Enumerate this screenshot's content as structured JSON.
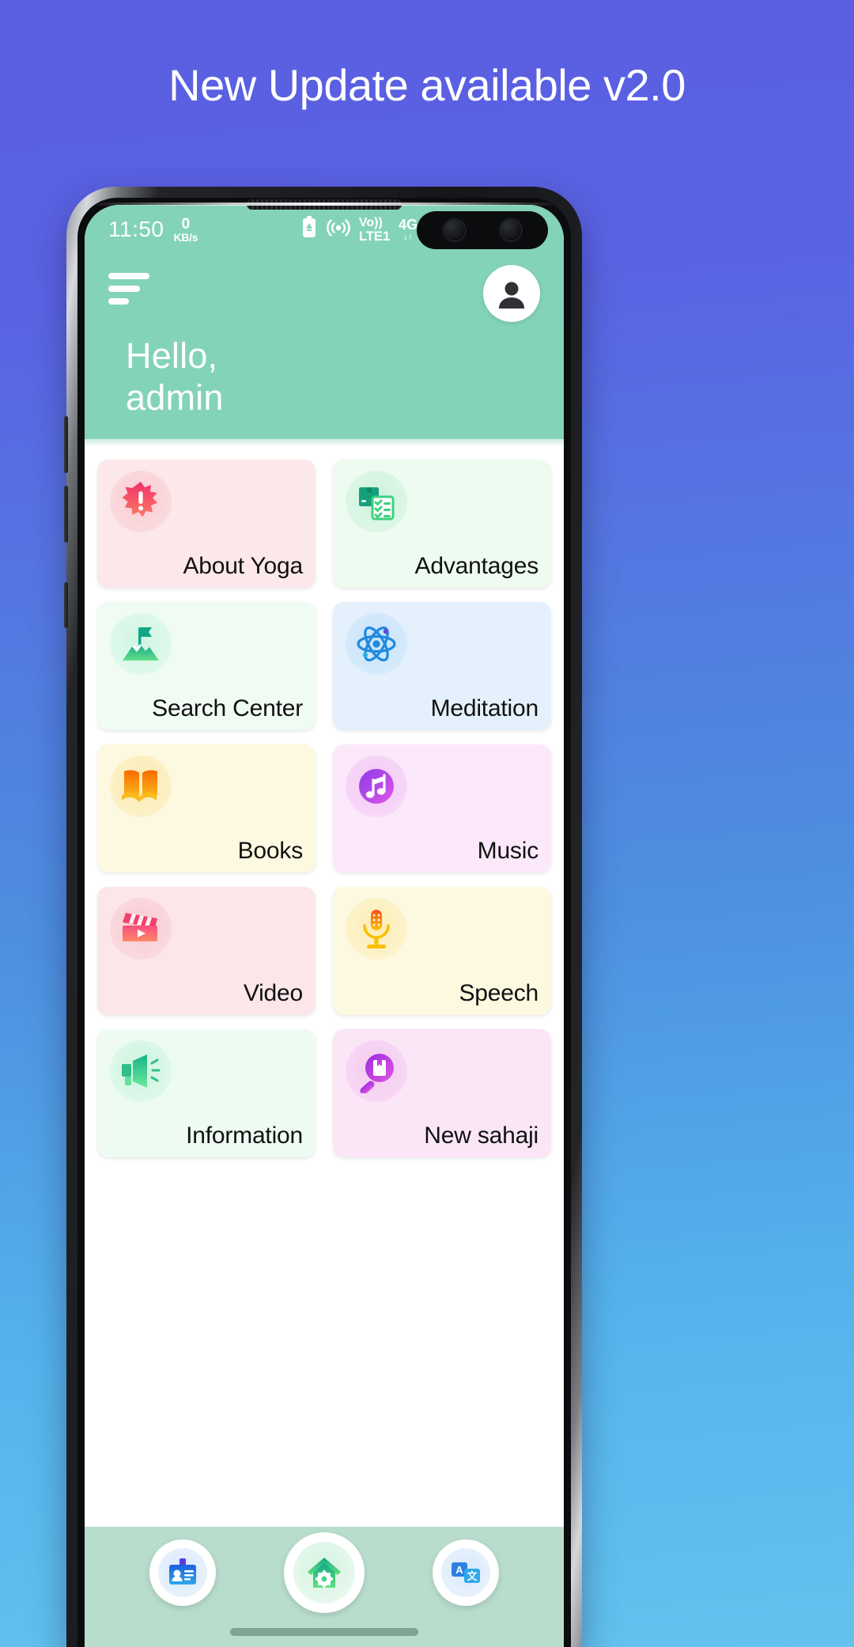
{
  "banner": {
    "text": "New Update available v2.0",
    "text_color": "#ffffff"
  },
  "statusbar": {
    "time": "11:50",
    "net_speed_value": "0",
    "net_speed_unit": "KB/s",
    "volte_line1": "Vo))",
    "volte_line2": "LTE1",
    "network_type": "4G",
    "network_sub": "↓↑",
    "battery": "",
    "icons": [
      "eco-battery-icon",
      "hotspot-icon",
      "volte-icon",
      "signal-icon"
    ]
  },
  "header": {
    "menu_icon": "hamburger-icon",
    "avatar_icon": "user-avatar-icon",
    "greeting_line1": "Hello,",
    "greeting_line2": "admin",
    "bg_color": "#83d3b8"
  },
  "grid": {
    "cards": [
      {
        "label": "About Yoga",
        "icon": "starburst-alert-icon",
        "card_bg": "#fce8ea",
        "icon_bg": "#f9d4d8",
        "accent": "#f2355f"
      },
      {
        "label": "Advantages",
        "icon": "package-checklist-icon",
        "card_bg": "#eefbf1",
        "icon_bg": "#d3f4dd",
        "accent": "#17a673"
      },
      {
        "label": "Search Center",
        "icon": "mountain-flag-icon",
        "card_bg": "#f0fbf3",
        "icon_bg": "#d4f6e0",
        "accent": "#2ec27e"
      },
      {
        "label": "Meditation",
        "icon": "atom-icon",
        "card_bg": "#e4f1fc",
        "icon_bg": "#cbe5fa",
        "accent": "#2f7fe0"
      },
      {
        "label": "Books",
        "icon": "open-book-icon",
        "card_bg": "#fdf9e1",
        "icon_bg": "#fbeec2",
        "accent": "#f58000"
      },
      {
        "label": "Music",
        "icon": "music-note-icon",
        "card_bg": "#fbe9fb",
        "icon_bg": "#f5d3f6",
        "accent": "#b43ce0"
      },
      {
        "label": "Video",
        "icon": "clapperboard-icon",
        "card_bg": "#fce6e9",
        "icon_bg": "#f9d2d8",
        "accent": "#f43f6b"
      },
      {
        "label": "Speech",
        "icon": "microphone-icon",
        "card_bg": "#fdf8e0",
        "icon_bg": "#fbedbf",
        "accent": "#f5a000"
      },
      {
        "label": "Information",
        "icon": "megaphone-icon",
        "card_bg": "#eefbf2",
        "icon_bg": "#d2f5e0",
        "accent": "#23b87c"
      },
      {
        "label": "New sahaji",
        "icon": "magnifier-book-icon",
        "card_bg": "#fbe6f8",
        "icon_bg": "#f6d1f2",
        "accent": "#bb3ce0"
      }
    ]
  },
  "bottomnav": {
    "bg_color": "#b8ddcd",
    "items": [
      {
        "name": "profile-card-icon",
        "label": "Profile"
      },
      {
        "name": "home-settings-icon",
        "label": "Home"
      },
      {
        "name": "translate-icon",
        "label": "Translate"
      }
    ],
    "home_indicator": "home-indicator"
  }
}
